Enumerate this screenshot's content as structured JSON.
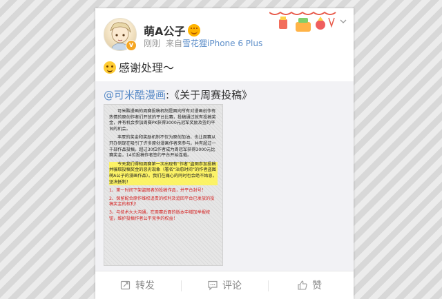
{
  "user": {
    "name": "萌A公子",
    "time": "刚刚",
    "source_prefix": "来自",
    "device": "雪花狸iPhone 6 Plus"
  },
  "post": {
    "text": "感谢处理～",
    "emoji_icon": "smile-emoji-icon"
  },
  "repost": {
    "mention": "@可米酷漫画",
    "separator": ":",
    "title": "《关于周赛投稿》",
    "doc": {
      "p1": "可米酷漫画的周赛投稿机制是面向所有对漫画创作有热情的原创作者们开放的平台比赛，投稿通过就有投稿奖金，并有机会参加周赛PK获得3000元冠军奖励及签约平台的机会。",
      "p2": "丰厚的奖金和奖励机制不仅为原创加油，也让周赛从开办到现在吸引了许多原创漫画作者来参与。共有超过一千部作品投稿，超过30位作者成为周冠军获得3000元比赛奖金，14位投稿作者签约平台开始连载。",
      "p3": "今天我们得知周赛第一次出现有“作者”盗图参加投稿并骗取投稿奖金的恶劣现象（署名“治愈时间”的作者盗图萌A公子的漫画作品）。我们在痛心的同时也会绝不姑息，坚决抵制！",
      "r1": "1、第一时间下架盗图者的投稿作品，并平台封号！",
      "r2": "2、保留配合原作维权追责的权利及追回平台已发放的投稿奖金的权利！",
      "r3": "3、与技术大大沟通，在周赛后面的版本中增加举报按钮，维护投稿作者公平竞争的权益！"
    }
  },
  "footer": {
    "repost_label": "转发",
    "comment_label": "评论",
    "like_label": "赞"
  },
  "colors": {
    "link": "#5a8cc8",
    "warning_text": "#d42020",
    "highlight": "#fff550"
  }
}
